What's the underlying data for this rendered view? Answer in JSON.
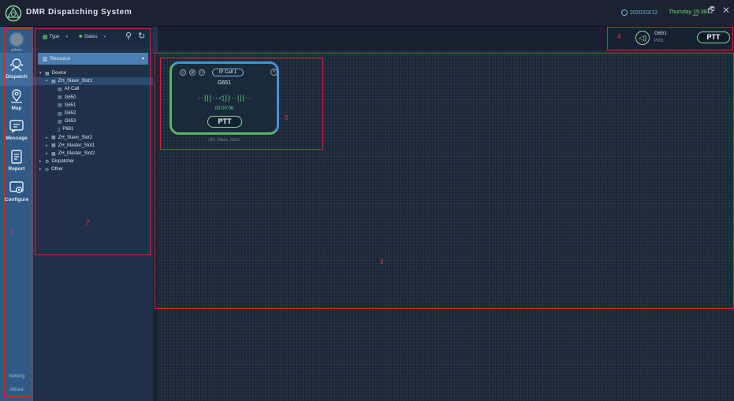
{
  "app": {
    "title": "DMR Dispatching System",
    "date": "2020/03/12",
    "day_time": "Thursday 15:38",
    "controls": {
      "minimize": "_",
      "restore": "🗗",
      "close": "✕"
    }
  },
  "sidebar": {
    "user_name": "admin",
    "items": [
      {
        "label": "Dispatch",
        "icon": "dispatch-icon",
        "active": true
      },
      {
        "label": "Map",
        "icon": "map-pin-icon",
        "active": false
      },
      {
        "label": "Message",
        "icon": "message-icon",
        "active": false
      },
      {
        "label": "Report",
        "icon": "report-icon",
        "active": false
      },
      {
        "label": "Configure",
        "icon": "configure-icon",
        "active": false
      }
    ],
    "setting_label": "Setting",
    "about_label": "About"
  },
  "resource_panel": {
    "filters": {
      "type_label": "Type",
      "states_label": "States"
    },
    "resource_header": "Resource",
    "tree": [
      {
        "label": "Device",
        "level": 0,
        "arrow": "▾",
        "icon": "▦"
      },
      {
        "label": "ZH_Slave_Slot1",
        "level": 1,
        "arrow": "▾",
        "icon": "▦",
        "selected": true
      },
      {
        "label": "All Call",
        "level": 2,
        "arrow": "",
        "icon": "▤"
      },
      {
        "label": "G650",
        "level": 2,
        "arrow": "",
        "icon": "▤"
      },
      {
        "label": "G651",
        "level": 2,
        "arrow": "",
        "icon": "▤"
      },
      {
        "label": "G652",
        "level": 2,
        "arrow": "",
        "icon": "▤"
      },
      {
        "label": "G653",
        "level": 2,
        "arrow": "",
        "icon": "▤"
      },
      {
        "label": "P681",
        "level": 2,
        "arrow": "",
        "icon": "▯"
      },
      {
        "label": "ZH_Slave_Slot2",
        "level": 1,
        "arrow": "▸",
        "icon": "▦"
      },
      {
        "label": "ZH_Master_Slot1",
        "level": 1,
        "arrow": "▸",
        "icon": "▦"
      },
      {
        "label": "ZH_Master_Slot2",
        "level": 1,
        "arrow": "▸",
        "icon": "▦"
      },
      {
        "label": "Dispatcher",
        "level": 0,
        "arrow": "▸",
        "icon": "⚙"
      },
      {
        "label": "Other",
        "level": 0,
        "arrow": "▸",
        "icon": "⊖"
      }
    ]
  },
  "ptt_bar": {
    "name": "G651",
    "sub": "P681",
    "button_label": "PTT"
  },
  "call_card": {
    "badge": "IP Call 1",
    "title": "G651",
    "wave": "··|||··◁))··|||··",
    "timer": "00:00:06",
    "ptt_label": "PTT",
    "caption": "ZH_Slave_Slot1"
  },
  "annotations": [
    "1",
    "2",
    "3",
    "4",
    "5"
  ],
  "colors": {
    "accent_green": "#5fd38b",
    "accent_blue": "#4a90d9",
    "annotation_red": "#d8262d",
    "sidebar": "#2f5a85"
  }
}
